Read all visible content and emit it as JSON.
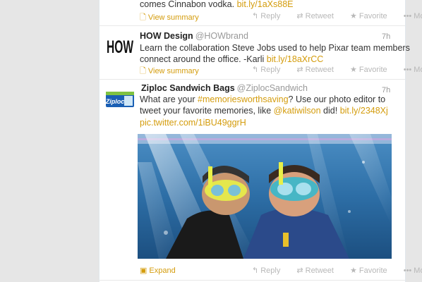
{
  "tweet1": {
    "text": "comes Cinnabon vodka.",
    "link": "bit.ly/1aXs88E",
    "summary_label": "View summary",
    "actions": [
      "Reply",
      "Retweet",
      "Favorite",
      "More"
    ]
  },
  "tweet2": {
    "avatar_text": "HOW",
    "name": "HOW Design",
    "handle": "@HOWbrand",
    "time": "7h",
    "line1": "Learn the collaboration Steve Jobs used to help Pixar team members",
    "line2_text": "connect around the office. -Karli",
    "link": "bit.ly/18aXrCC",
    "summary_label": "View summary",
    "actions": [
      "Reply",
      "Retweet",
      "Favorite",
      "More"
    ]
  },
  "tweet3": {
    "avatar_text": "Ziploc",
    "name": "Ziploc Sandwich Bags",
    "handle": "@ZiplocSandwich",
    "time": "7h",
    "line1_pre": "What are your",
    "hashtag": "#memoriesworthsaving",
    "line1_post": "? Use our photo editor to",
    "line2_pre": "tweet your favorite memories, like",
    "mention": "@katiwilson",
    "line2_mid": "did!",
    "link": "bit.ly/2348Xj",
    "pic_link": "pic.twitter.com/1iBU49ggrH",
    "expand_label": "Expand",
    "actions": [
      "Reply",
      "Retweet",
      "Favorite",
      "More"
    ]
  },
  "colors": {
    "link": "#d49c0c",
    "text": "#333333",
    "muted": "#999999"
  }
}
